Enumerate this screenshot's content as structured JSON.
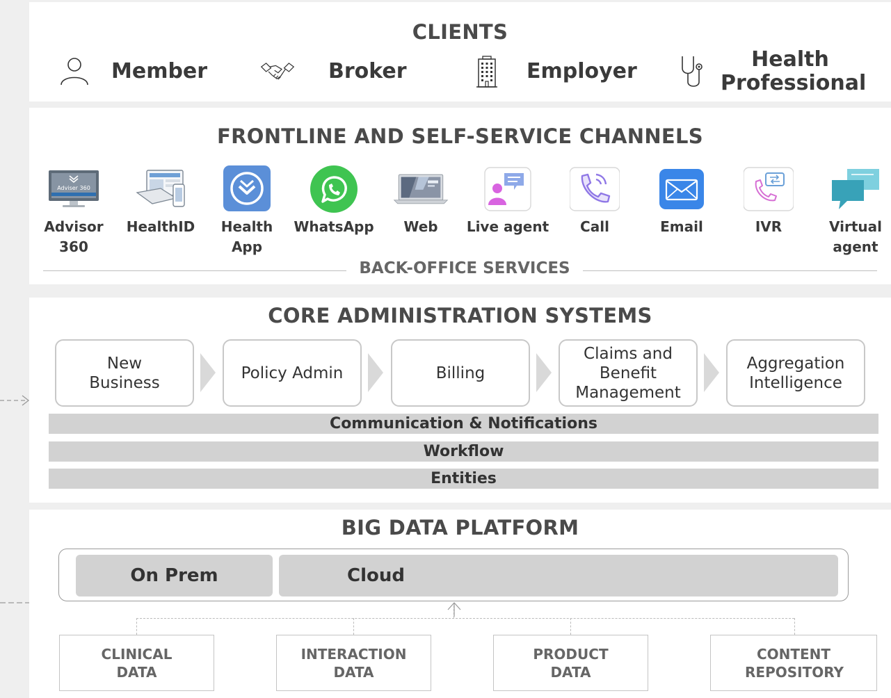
{
  "clients": {
    "title": "CLIENTS",
    "items": [
      {
        "label": "Member",
        "icon": "person-icon"
      },
      {
        "label": "Broker",
        "icon": "handshake-icon"
      },
      {
        "label": "Employer",
        "icon": "building-icon"
      },
      {
        "label": "Health Professional",
        "icon": "stethoscope-icon"
      }
    ]
  },
  "channels": {
    "title": "FRONTLINE AND SELF-SERVICE CHANNELS",
    "items": [
      {
        "label": "Advisor 360",
        "icon": "monitor-icon",
        "screen_text": "Adviser 360"
      },
      {
        "label": "HealthID",
        "icon": "devices-icon"
      },
      {
        "label": "Health App",
        "icon": "app-icon"
      },
      {
        "label": "WhatsApp",
        "icon": "whatsapp-icon"
      },
      {
        "label": "Web",
        "icon": "laptop-icon"
      },
      {
        "label": "Live agent",
        "icon": "chat-agent-icon"
      },
      {
        "label": "Call",
        "icon": "phone-icon"
      },
      {
        "label": "Email",
        "icon": "envelope-icon"
      },
      {
        "label": "IVR",
        "icon": "ivr-icon"
      },
      {
        "label": "Virtual agent",
        "icon": "speech-bubbles-icon"
      }
    ],
    "back_office_label": "BACK-OFFICE SERVICES"
  },
  "core": {
    "title": "CORE ADMINISTRATION SYSTEMS",
    "processes": [
      "New Business",
      "Policy Admin",
      "Billing",
      "Claims and Benefit Management",
      "Aggregation Intelligence"
    ],
    "bars": [
      "Communication & Notifications",
      "Workflow",
      "Entities"
    ]
  },
  "bigdata": {
    "title": "BIG DATA PLATFORM",
    "on_prem": "On Prem",
    "cloud": "Cloud",
    "sources": [
      "CLINICAL DATA",
      "INTERACTION DATA",
      "PRODUCT DATA",
      "CONTENT REPOSITORY"
    ]
  },
  "colors": {
    "title_text": "#4a4a4a",
    "panel_bg": "#ffffff",
    "page_bg": "#efefef",
    "bar_fill": "#d2d2d2",
    "whatsapp": "#3fc451",
    "health_app": "#5b8fd8",
    "email": "#3a86e8",
    "virtual_agent": "#38a2b8"
  }
}
